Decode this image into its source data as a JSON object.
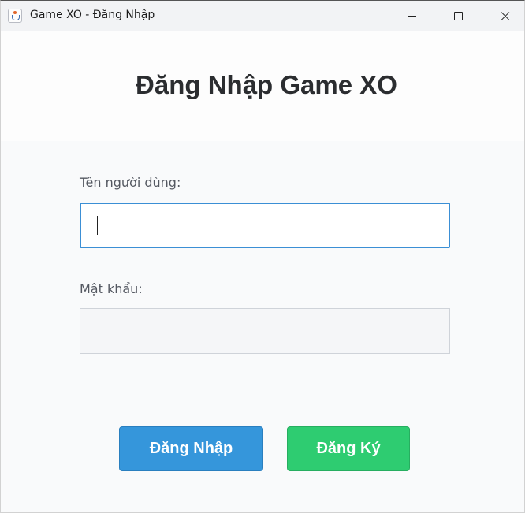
{
  "window": {
    "title": "Game XO - Đăng Nhập"
  },
  "form": {
    "heading": "Đăng Nhập Game XO",
    "username": {
      "label": "Tên người dùng:",
      "value": ""
    },
    "password": {
      "label": "Mật khẩu:",
      "value": ""
    }
  },
  "buttons": {
    "login": "Đăng Nhập",
    "register": "Đăng Ký"
  },
  "colors": {
    "login_button": "#3596db",
    "register_button": "#2ecc71",
    "focus_border": "#3b8fd5"
  },
  "icons": {
    "app": "java-coffee-icon",
    "minimize": "minimize-icon",
    "maximize": "maximize-icon",
    "close": "close-icon"
  }
}
